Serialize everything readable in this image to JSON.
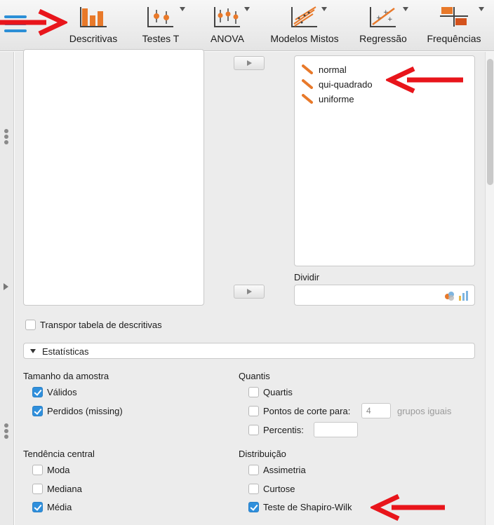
{
  "toolbar": {
    "items": [
      {
        "label": "Descritivas",
        "icon": "descriptives-bar-icon"
      },
      {
        "label": "Testes T",
        "icon": "t-test-icon"
      },
      {
        "label": "ANOVA",
        "icon": "anova-icon"
      },
      {
        "label": "Modelos Mistos",
        "icon": "mixed-models-icon"
      },
      {
        "label": "Regressão",
        "icon": "regression-icon"
      },
      {
        "label": "Frequências",
        "icon": "frequencies-icon"
      }
    ]
  },
  "variables": {
    "selected": [
      "normal",
      "qui-quadrado",
      "uniforme"
    ]
  },
  "split": {
    "label": "Dividir"
  },
  "options": {
    "transpose_label": "Transpor tabela de descritivas",
    "statistics_label": "Estatísticas"
  },
  "statistics": {
    "sample_size": {
      "title": "Tamanho da amostra",
      "valid": "Válidos",
      "missing": "Perdidos (missing)"
    },
    "quantiles": {
      "title": "Quantis",
      "quartiles": "Quartis",
      "cut_points": "Pontos de corte para:",
      "cut_points_value": "4",
      "equal_groups": "grupos iguais",
      "percentiles": "Percentis:"
    },
    "central_tendency": {
      "title": "Tendência central",
      "mode": "Moda",
      "median": "Mediana",
      "mean": "Média"
    },
    "distribution": {
      "title": "Distribuição",
      "skewness": "Assimetria",
      "kurtosis": "Curtose",
      "shapiro": "Teste de Shapiro-Wilk"
    }
  },
  "colors": {
    "accent": "#2f8fdc",
    "annotation": "#e8151b",
    "icon_orange": "#e8792a"
  }
}
